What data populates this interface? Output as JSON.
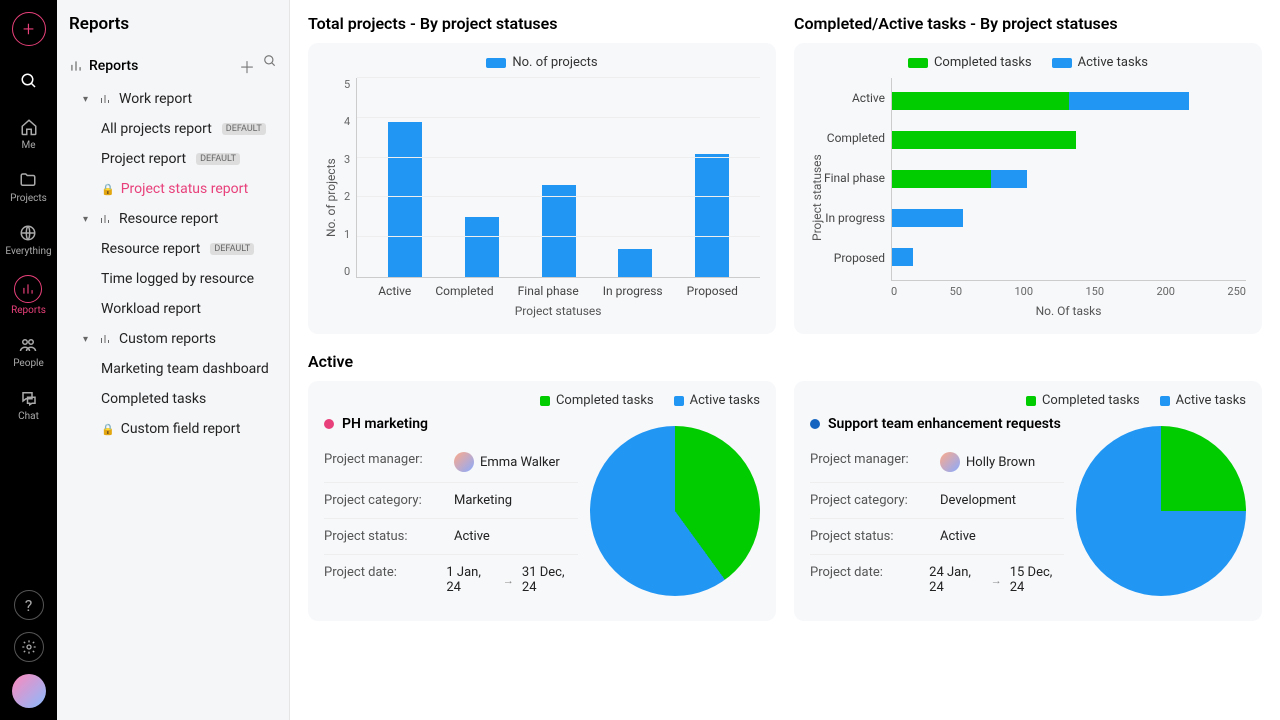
{
  "rail": {
    "items": [
      {
        "id": "me",
        "label": "Me"
      },
      {
        "id": "projects",
        "label": "Projects"
      },
      {
        "id": "everything",
        "label": "Everything"
      },
      {
        "id": "reports",
        "label": "Reports"
      },
      {
        "id": "people",
        "label": "People"
      },
      {
        "id": "chat",
        "label": "Chat"
      }
    ]
  },
  "sidebar": {
    "title": "Reports",
    "root": "Reports",
    "groups": [
      {
        "label": "Work report",
        "items": [
          {
            "label": "All projects report",
            "badge": "DEFAULT"
          },
          {
            "label": "Project report",
            "badge": "DEFAULT"
          },
          {
            "label": "Project status report",
            "locked": true,
            "selected": true
          }
        ]
      },
      {
        "label": "Resource report",
        "items": [
          {
            "label": "Resource report",
            "badge": "DEFAULT"
          },
          {
            "label": "Time logged by resource"
          },
          {
            "label": "Workload report"
          }
        ]
      },
      {
        "label": "Custom reports",
        "items": [
          {
            "label": "Marketing team dashboard"
          },
          {
            "label": "Completed tasks"
          },
          {
            "label": "Custom field report",
            "locked": true
          }
        ]
      }
    ]
  },
  "charts": {
    "totalProjects": {
      "title": "Total projects - By project statuses",
      "legend": "No. of projects",
      "xlabel": "Project statuses",
      "ylabel": "No. of projects"
    },
    "completedActive": {
      "title": "Completed/Active tasks - By project statuses",
      "legend": [
        "Completed tasks",
        "Active tasks"
      ],
      "xlabel": "No. Of tasks",
      "ylabel": "Project statuses"
    }
  },
  "section": {
    "active": "Active"
  },
  "proj1": {
    "title": "PH marketing",
    "manager_label": "Project manager:",
    "manager": "Emma Walker",
    "category_label": "Project category:",
    "category": "Marketing",
    "status_label": "Project status:",
    "status": "Active",
    "date_label": "Project date:",
    "date_from": "1 Jan, 24",
    "date_to": "31 Dec, 24",
    "legend": [
      "Completed tasks",
      "Active tasks"
    ]
  },
  "proj2": {
    "title": "Support team enhancement requests",
    "manager_label": "Project manager:",
    "manager": "Holly Brown",
    "category_label": "Project category:",
    "category": "Development",
    "status_label": "Project status:",
    "status": "Active",
    "date_label": "Project date:",
    "date_from": "24 Jan, 24",
    "date_to": "15 Dec, 24",
    "legend": [
      "Completed tasks",
      "Active tasks"
    ]
  },
  "chart_data": [
    {
      "id": "totalProjects",
      "type": "bar",
      "title": "Total projects - By project statuses",
      "xlabel": "Project statuses",
      "ylabel": "No. of projects",
      "categories": [
        "Active",
        "Completed",
        "Final phase",
        "In progress",
        "Proposed"
      ],
      "values": [
        3.9,
        1.5,
        2.3,
        0.7,
        3.1
      ],
      "ylim": [
        0,
        5
      ],
      "series_name": "No. of projects"
    },
    {
      "id": "completedActive",
      "type": "bar-horizontal-stacked",
      "title": "Completed/Active tasks - By project statuses",
      "xlabel": "No. Of tasks",
      "ylabel": "Project statuses",
      "categories": [
        "Active",
        "Completed",
        "Final phase",
        "In progress",
        "Proposed"
      ],
      "series": [
        {
          "name": "Completed tasks",
          "values": [
            125,
            130,
            70,
            0,
            0
          ],
          "color": "#00cc00"
        },
        {
          "name": "Active tasks",
          "values": [
            85,
            0,
            25,
            50,
            15
          ],
          "color": "#2196f3"
        }
      ],
      "xlim": [
        0,
        250
      ],
      "xticks": [
        0,
        50,
        100,
        150,
        200,
        250
      ]
    },
    {
      "id": "proj1-pie",
      "type": "pie",
      "title": "PH marketing",
      "series": [
        {
          "name": "Completed tasks",
          "value": 40,
          "color": "#00cc00"
        },
        {
          "name": "Active tasks",
          "value": 60,
          "color": "#2196f3"
        }
      ]
    },
    {
      "id": "proj2-pie",
      "type": "pie",
      "title": "Support team enhancement requests",
      "series": [
        {
          "name": "Completed tasks",
          "value": 25,
          "color": "#00cc00"
        },
        {
          "name": "Active tasks",
          "value": 75,
          "color": "#2196f3"
        }
      ]
    }
  ]
}
